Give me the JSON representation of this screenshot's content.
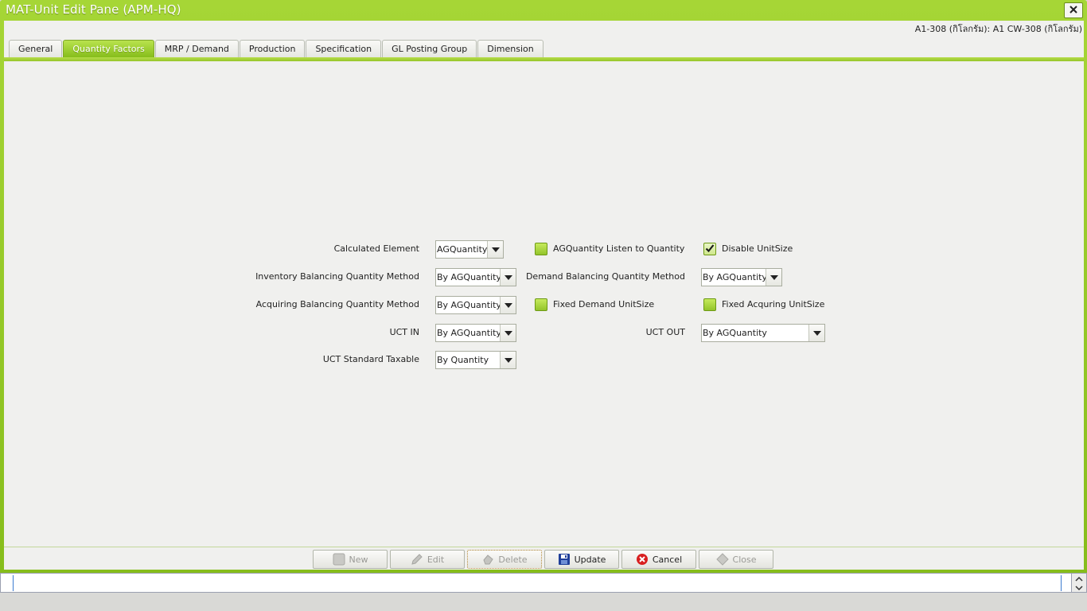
{
  "window": {
    "title": "MAT-Unit Edit Pane (APM-HQ)"
  },
  "breadcrumb": "A1-308 (กิโลกรัม): A1 CW-308 (กิโลกรัม)",
  "tabs": [
    {
      "label": "General",
      "active": false
    },
    {
      "label": "Quantity Factors",
      "active": true
    },
    {
      "label": "MRP / Demand",
      "active": false
    },
    {
      "label": "Production",
      "active": false
    },
    {
      "label": "Specification",
      "active": false
    },
    {
      "label": "GL Posting Group",
      "active": false
    },
    {
      "label": "Dimension",
      "active": false
    }
  ],
  "form": {
    "calculated_element": {
      "label": "Calculated Element",
      "value": "AGQuantity"
    },
    "ag_listen": {
      "label": "AGQuantity Listen to Quantity",
      "checked": false
    },
    "disable_unitsize": {
      "label": "Disable UnitSize",
      "checked": true
    },
    "inventory_balancing": {
      "label": "Inventory Balancing Quantity Method",
      "value": "By AGQuantity"
    },
    "demand_balancing": {
      "label": "Demand Balancing Quantity Method",
      "value": "By AGQuantity"
    },
    "acquiring_balancing": {
      "label": "Acquiring Balancing Quantity Method",
      "value": "By AGQuantity"
    },
    "fixed_demand": {
      "label": "Fixed Demand UnitSize",
      "checked": false
    },
    "fixed_acquring": {
      "label": "Fixed Acquring UnitSize",
      "checked": false
    },
    "uct_in": {
      "label": "UCT IN",
      "value": "By AGQuantity"
    },
    "uct_out": {
      "label": "UCT OUT",
      "value": "By AGQuantity"
    },
    "uct_taxable": {
      "label": "UCT Standard Taxable",
      "value": "By Quantity"
    }
  },
  "buttons": {
    "new": "New",
    "edit": "Edit",
    "delete": "Delete",
    "update": "Update",
    "cancel": "Cancel",
    "close": "Close"
  },
  "colors": {
    "accent": "#8cc121",
    "window_bg": "#f0f0ee"
  }
}
